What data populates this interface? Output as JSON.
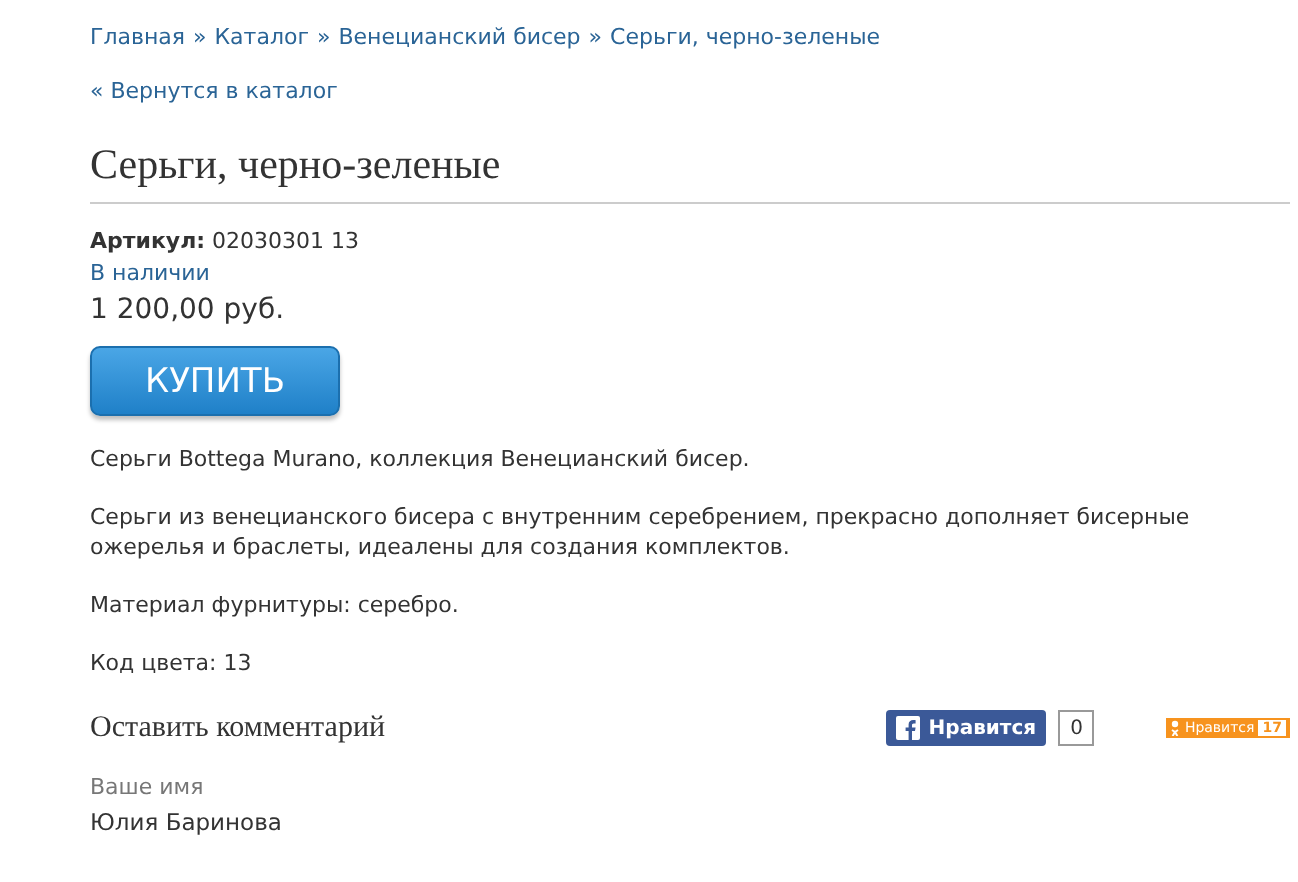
{
  "breadcrumbs": {
    "separator": "»",
    "items": [
      {
        "label": "Главная"
      },
      {
        "label": "Каталог"
      },
      {
        "label": "Венецианский бисер"
      },
      {
        "label": "Серьги, черно-зеленые"
      }
    ]
  },
  "back_link": "« Вернутся в каталог",
  "title": "Серьги, черно-зеленые",
  "sku": {
    "label": "Артикул:",
    "value": "02030301 13"
  },
  "availability": "В наличии",
  "price": "1 200,00 руб.",
  "buy_button": "КУПИТЬ",
  "description": [
    "Серьги Bottega Murano, коллекция Венецианский бисер.",
    "Серьги из венецианского бисера с внутренним серебрением, прекрасно дополняет бисерные ожерелья и браслеты, идеалены для создания комплектов.",
    "Материал фурнитуры: серебро.",
    "Код цвета: 13"
  ],
  "comments": {
    "heading": "Оставить комментарий",
    "name_label": "Ваше имя",
    "name_value": "Юлия Баринова"
  },
  "social": [
    {
      "kind": "facebook",
      "label": "Нравится",
      "count": "0"
    },
    {
      "kind": "odnoklassniki",
      "label": "Нравится",
      "count": "17"
    }
  ]
}
